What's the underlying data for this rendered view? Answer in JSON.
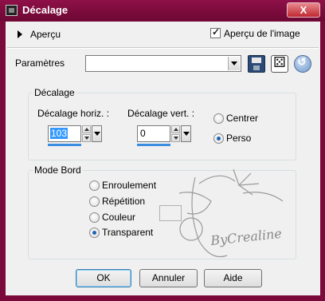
{
  "window": {
    "title": "Décalage",
    "close_label": "X"
  },
  "preview": {
    "label": "Aperçu",
    "image_preview_label": "Aperçu de l'image",
    "image_preview_checked": true
  },
  "presets": {
    "label": "Paramètres",
    "value": ""
  },
  "offset_group": {
    "title": "Décalage",
    "horizontal": {
      "label": "Décalage horiz. :",
      "value": "103"
    },
    "vertical": {
      "label": "Décalage vert. :",
      "value": "0"
    },
    "options": [
      {
        "label": "Centrer",
        "selected": false
      },
      {
        "label": "Perso",
        "selected": true
      }
    ]
  },
  "edge_group": {
    "title": "Mode Bord",
    "options": [
      {
        "label": "Enroulement",
        "selected": false
      },
      {
        "label": "Répétition",
        "selected": false
      },
      {
        "label": "Couleur",
        "selected": false
      },
      {
        "label": "Transparent",
        "selected": true
      }
    ]
  },
  "watermark_text": "ByCrealine",
  "buttons": {
    "ok": "OK",
    "cancel": "Annuler",
    "help": "Aide"
  },
  "colors": {
    "title_bar": "#7a0a3a",
    "close_button": "#c0282f",
    "dialog_bg": "#f0f0f0",
    "selection": "#3399ff"
  }
}
